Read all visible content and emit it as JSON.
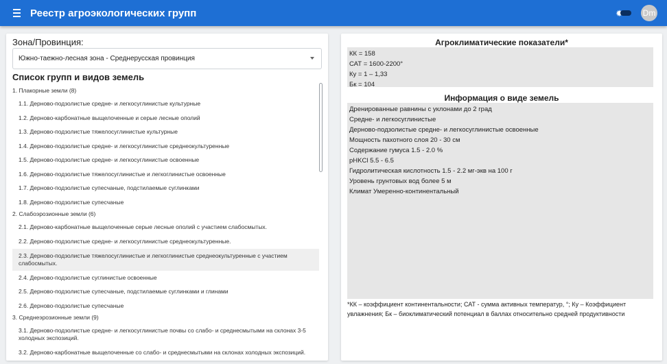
{
  "app": {
    "title": "Реестр агроэкологических групп",
    "avatar": "Dm"
  },
  "zone": {
    "label": "Зона/Провинция:",
    "selected": "Южно-таежно-лесная зона - Среднерусская провинция"
  },
  "list": {
    "title": "Список групп и видов земель",
    "groups": [
      {
        "label": "1. Плакорные земли (8)",
        "items": [
          "1.1. Дерново-подзолистые средне- и легкосуглинистые культурные",
          "1.2. Дерново-карбонатные выщелоченные и серые лесные ополий",
          "1.3. Дерново-подзолистые тяжелосуглинистые культурные",
          "1.4. Дерново-подзолистые средне- и легкосуглинистые среднеокультуренные",
          "1.5. Дерново-подзолистые средне- и легкосуглинистые освоенные",
          "1.6. Дерново-подзолистые тяжелосуглинистые и легкоглинистые освоенные",
          "1.7. Дерново-подзолистые супесчаные, подстилаемые суглинками",
          "1.8. Дерново-подзолистые супесчаные"
        ]
      },
      {
        "label": "2. Слабоэрозионные земли (6)",
        "items": [
          "2.1. Дерново-карбонатные выщелоченные серые лесные ополий с участием слабосмытых.",
          "2.2. Дерново-подзолистые средне- и легкосуглинистые среднеокультуренные.",
          "2.3. Дерново-подзолистые тяжелосуглинистые и легкоглинистые среднеокультуренные с участием слабосмытых.",
          "2.4. Дерново-подзолистые суглинистые освоенные",
          "2.5. Дерново-подзолистые супесчаные, подстилаемые суглинками и глинами",
          "2.6. Дерново-подзолистые супесчаные"
        ]
      },
      {
        "label": "3. Среднеэрозионные земли (9)",
        "items": [
          "3.1. Дерново-подзолистые средне- и легкосуглинистые почвы со слабо- и среднесмытыми на склонах 3-5 холодных экспозиций.",
          "3.2. Дерново-карбонатные выщелоченные со слабо- и среднесмытыми на склонах холодных экспозиций."
        ]
      }
    ]
  },
  "agro": {
    "title": "Агроклиматические показатели*",
    "lines": [
      "КК = 158",
      "САТ = 1600-2200°",
      "Ку = 1 – 1,33",
      "Бк = 104"
    ]
  },
  "info": {
    "title": "Информация о виде земель",
    "lines": [
      "Дренированные равнины с уклонами до 2 град",
      "Средне- и легкосуглинистые",
      "Дерново-подзолистые средне- и легкосуглинистые освоенные",
      "Мощность пахотного слоя 20 - 30 см",
      "Содержание гумуса 1.5 - 2.0 %",
      "pHKCl 5.5 - 6.5",
      "Гидролитическая кислотность 1.5 - 2.2 мг-экв на 100 г",
      "Уровень грунтовых вод более 5 м",
      "Климат Умеренно-континентальный"
    ]
  },
  "footnote": "*КК – коэффициент континентальности; САТ - сумма активных температур, °; Ку – Коэффициент увлажнения; Бк – биоклиматический потенциал в баллах относительно средней продуктивности",
  "colors": {
    "appbar": "#1e6fd4",
    "selected_row": "#efefef",
    "info_box": "#e6e6e6"
  }
}
